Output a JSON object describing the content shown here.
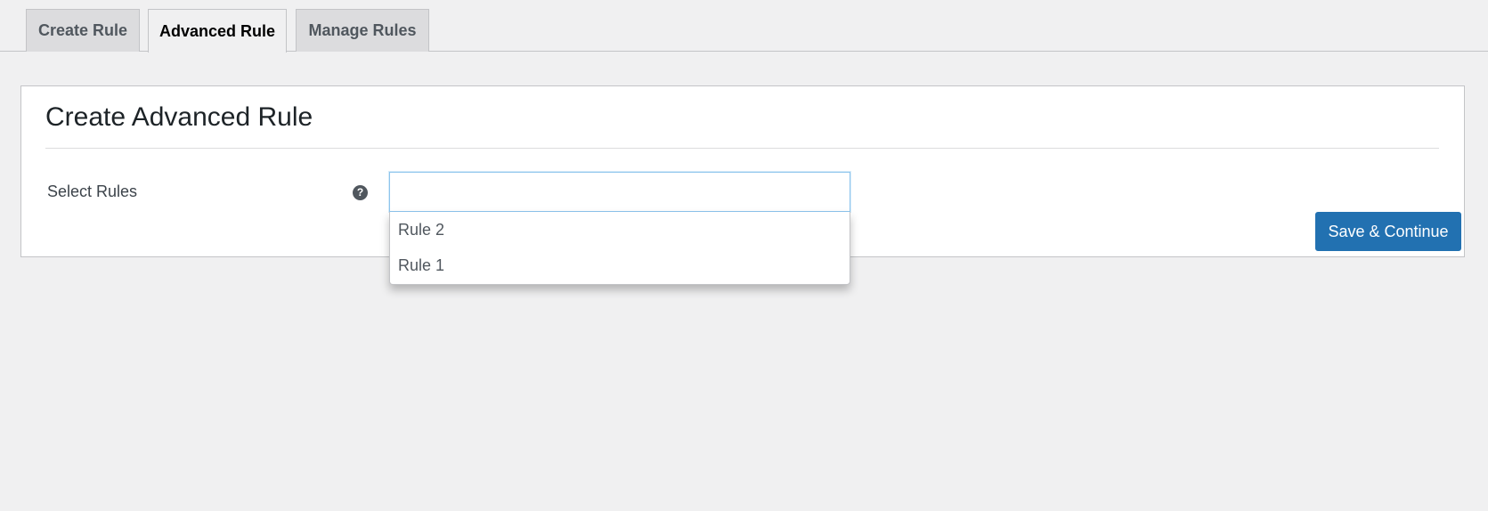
{
  "tabs": [
    {
      "label": "Create Rule",
      "active": false
    },
    {
      "label": "Advanced Rule",
      "active": true
    },
    {
      "label": "Manage Rules",
      "active": false
    }
  ],
  "panel": {
    "title": "Create Advanced Rule",
    "field_label": "Select Rules",
    "help_icon": "?",
    "select": {
      "value": "",
      "placeholder": ""
    },
    "options": [
      "Rule 2",
      "Rule 1"
    ],
    "save_label": "Save & Continue"
  },
  "colors": {
    "accent": "#2271b1",
    "background": "#f0f0f1",
    "panel": "#ffffff",
    "focus_border": "#8ec5ed"
  }
}
